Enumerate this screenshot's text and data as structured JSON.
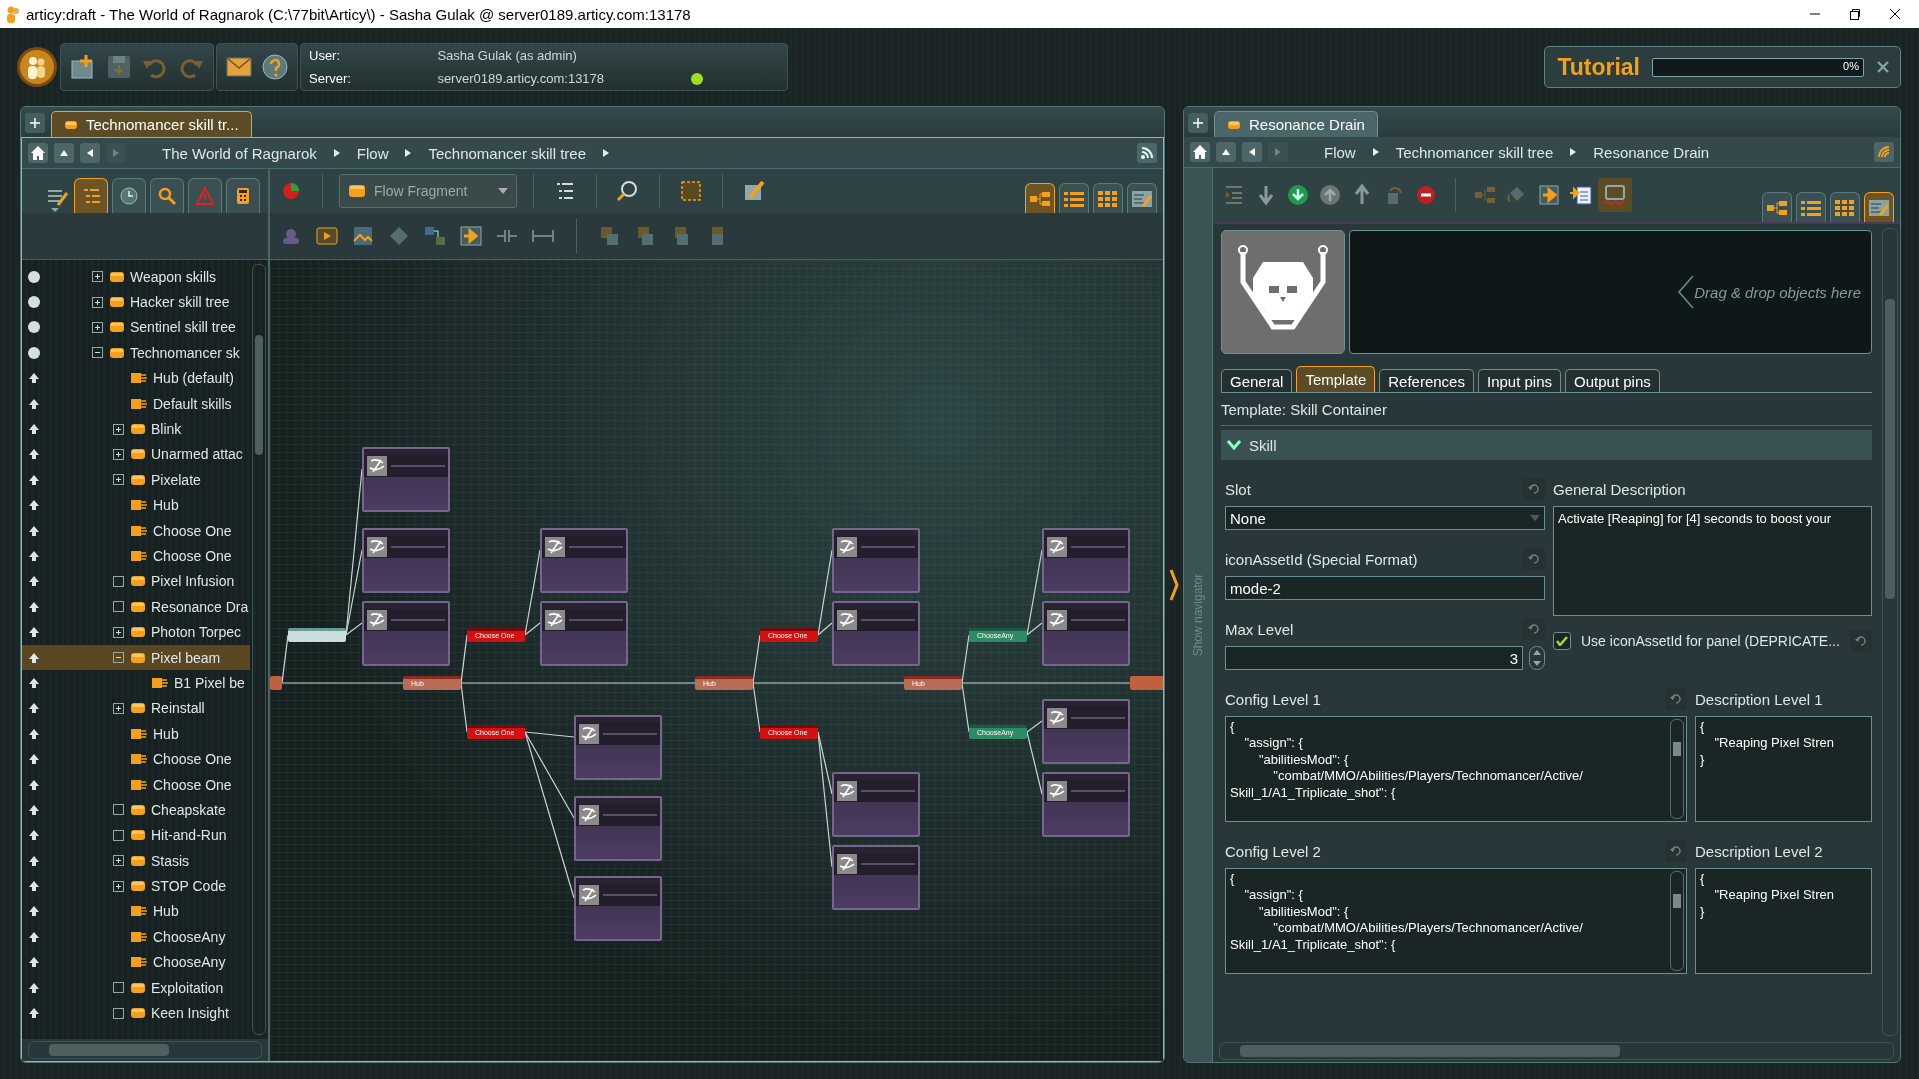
{
  "window": {
    "title": "articy:draft - The World of Ragnarok (C:\\77bit\\Articy\\) - Sasha Gulak @ server0189.articy.com:13178"
  },
  "session": {
    "user_label": "User:",
    "user": "Sasha Gulak (as admin)",
    "server_label": "Server:",
    "server": "server0189.articy.com:13178",
    "connected": true
  },
  "tutorial": {
    "title": "Tutorial",
    "level": 0,
    "reading": "0%"
  },
  "flow_panel": {
    "tab": "Technomancer skill tr...",
    "breadcrumb": [
      "The World of Ragnarok",
      "Flow",
      "Technomancer skill tree"
    ],
    "tree_tabs": [
      {
        "selected": true
      },
      {
        "selected": false
      },
      {
        "selected": false
      },
      {
        "selected": false
      },
      {
        "selected": false
      }
    ],
    "fragment_dropdown": "Flow Fragment",
    "views": [
      {
        "selected": true
      },
      {
        "selected": false
      },
      {
        "selected": false
      },
      {
        "selected": false
      }
    ],
    "tree": [
      {
        "label": "Weapon skills",
        "kind": "folder",
        "expanded": false,
        "leaf": false,
        "selected": false
      },
      {
        "label": "Hacker skill tree",
        "kind": "folder",
        "expanded": false,
        "leaf": false,
        "selected": false
      },
      {
        "label": "Sentinel skill tree",
        "kind": "folder",
        "expanded": false,
        "leaf": false,
        "selected": false
      },
      {
        "label": "Technomancer sk",
        "kind": "folder",
        "expanded": true,
        "leaf": false,
        "selected": false,
        "children": [
          {
            "label": "Hub (default)",
            "kind": "hub",
            "selected": false
          },
          {
            "label": "Default skills",
            "kind": "hub",
            "selected": false
          },
          {
            "label": "Blink",
            "kind": "folder",
            "expanded": false,
            "leaf": false,
            "selected": false
          },
          {
            "label": "Unarmed attac",
            "kind": "folder",
            "expanded": false,
            "leaf": false,
            "selected": false
          },
          {
            "label": "Pixelate",
            "kind": "folder",
            "expanded": false,
            "leaf": false,
            "selected": false
          },
          {
            "label": "Hub",
            "kind": "hub",
            "selected": false
          },
          {
            "label": "Choose One",
            "kind": "hub",
            "selected": false
          },
          {
            "label": "Choose One",
            "kind": "hub",
            "selected": false
          },
          {
            "label": "Pixel Infusion",
            "kind": "folder",
            "expanded": false,
            "leaf": true,
            "selected": false
          },
          {
            "label": "Resonance Dra",
            "kind": "folder",
            "expanded": false,
            "leaf": true,
            "selected": false
          },
          {
            "label": "Photon Torpec",
            "kind": "folder",
            "expanded": false,
            "leaf": false,
            "selected": false
          },
          {
            "label": "Pixel beam",
            "kind": "folder",
            "expanded": true,
            "leaf": false,
            "selected": true,
            "children": [
              {
                "label": "B1 Pixel be",
                "kind": "hub",
                "selected": false
              }
            ]
          },
          {
            "label": "Reinstall",
            "kind": "folder",
            "expanded": false,
            "leaf": false,
            "selected": false
          },
          {
            "label": "Hub",
            "kind": "hub",
            "selected": false
          },
          {
            "label": "Choose One",
            "kind": "hub",
            "selected": false
          },
          {
            "label": "Choose One",
            "kind": "hub",
            "selected": false
          },
          {
            "label": "Cheapskate",
            "kind": "folder",
            "expanded": false,
            "leaf": true,
            "selected": false
          },
          {
            "label": "Hit-and-Run",
            "kind": "folder",
            "expanded": false,
            "leaf": true,
            "selected": false
          },
          {
            "label": "Stasis",
            "kind": "folder",
            "expanded": false,
            "leaf": false,
            "selected": false
          },
          {
            "label": "STOP Code",
            "kind": "folder",
            "expanded": false,
            "leaf": false,
            "selected": false
          },
          {
            "label": "Hub",
            "kind": "hub",
            "selected": false
          },
          {
            "label": "ChooseAny",
            "kind": "hub",
            "selected": false
          },
          {
            "label": "ChooseAny",
            "kind": "hub",
            "selected": false
          },
          {
            "label": "Exploitation",
            "kind": "folder",
            "expanded": false,
            "leaf": true,
            "selected": false
          },
          {
            "label": "Keen Insight",
            "kind": "folder",
            "expanded": false,
            "leaf": true,
            "selected": false
          }
        ]
      }
    ],
    "nodes": [
      {
        "kind": "stub"
      },
      {
        "kind": "start"
      },
      {
        "kind": "skill"
      },
      {
        "kind": "skill"
      },
      {
        "kind": "skill"
      },
      {
        "kind": "hub",
        "label": "Hub"
      },
      {
        "kind": "choice",
        "label": "Choose One"
      },
      {
        "kind": "choice",
        "label": "Choose One"
      },
      {
        "kind": "skill"
      },
      {
        "kind": "skill"
      },
      {
        "kind": "skill"
      },
      {
        "kind": "skill"
      },
      {
        "kind": "skill"
      },
      {
        "kind": "hub",
        "label": "Hub"
      },
      {
        "kind": "choice",
        "label": "Choose One"
      },
      {
        "kind": "choice",
        "label": "Choose One"
      },
      {
        "kind": "skill"
      },
      {
        "kind": "skill"
      },
      {
        "kind": "skill"
      },
      {
        "kind": "skill"
      },
      {
        "kind": "hub",
        "label": "Hub"
      },
      {
        "kind": "any",
        "label": "ChooseAny"
      },
      {
        "kind": "any",
        "label": "ChooseAny"
      },
      {
        "kind": "skill"
      },
      {
        "kind": "skill"
      },
      {
        "kind": "skill"
      },
      {
        "kind": "skill"
      },
      {
        "kind": "stub"
      }
    ]
  },
  "property_panel": {
    "tab": "Resonance Drain",
    "breadcrumb": [
      "Flow",
      "Technomancer skill tree",
      "Resonance Drain"
    ],
    "views": [
      {
        "selected": false
      },
      {
        "selected": false
      },
      {
        "selected": false
      },
      {
        "selected": true
      }
    ],
    "navigator": "Show navigator",
    "drop_placeholder": "Drag & drop objects here",
    "tabs": [
      {
        "label": "General",
        "selected": false
      },
      {
        "label": "Template",
        "selected": true
      },
      {
        "label": "References",
        "selected": false
      },
      {
        "label": "Input pins",
        "selected": false
      },
      {
        "label": "Output pins",
        "selected": false
      }
    ],
    "template": "Template: Skill Container",
    "section": {
      "title": "Skill",
      "expanded": true
    },
    "slot": {
      "label": "Slot",
      "value": "None"
    },
    "icon_asset": {
      "label": "iconAssetId (Special Format)",
      "value": "mode-2"
    },
    "max_level": {
      "label": "Max Level",
      "value": "3"
    },
    "general_description": {
      "label": "General Description",
      "value": "Activate [Reaping] for [4] seconds to boost your"
    },
    "use_icon": {
      "label": "Use iconAssetId for panel (DEPRICATE...",
      "checked": true
    },
    "config_levels": [
      {
        "label": "Config Level 1",
        "code": "{\n    \"assign\": {\n        \"abilitiesMod\": {\n            \"combat/MMO/Abilities/Players/Technomancer/Active/\nSkill_1/A1_Triplicate_shot\": {",
        "description_label": "Description Level 1",
        "description": "{\n    \"Reaping Pixel Stren\n}"
      },
      {
        "label": "Config Level 2",
        "code": "{\n    \"assign\": {\n        \"abilitiesMod\": {\n            \"combat/MMO/Abilities/Players/Technomancer/Active/\nSkill_1/A1_Triplicate_shot\": {",
        "description_label": "Description Level 2",
        "description": "{\n    \"Reaping Pixel Stren\n}"
      }
    ]
  }
}
